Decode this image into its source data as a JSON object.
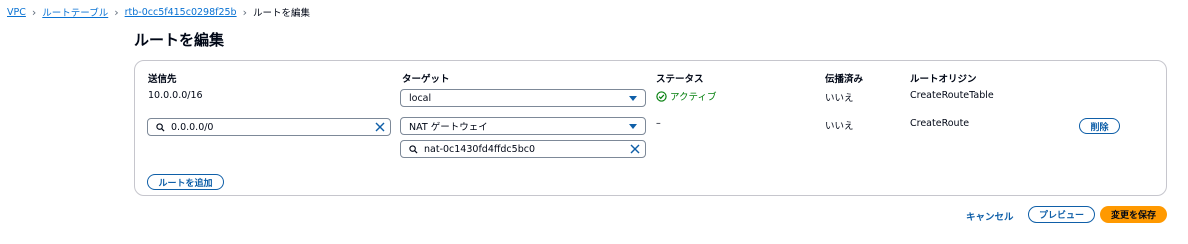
{
  "breadcrumb": {
    "items": [
      "VPC",
      "ルートテーブル",
      "rtb-0cc5f415c0298f25b"
    ],
    "current": "ルートを編集"
  },
  "page": {
    "title": "ルートを編集"
  },
  "table": {
    "headers": {
      "destination": "送信先",
      "target": "ターゲット",
      "status": "ステータス",
      "propagated": "伝播済み",
      "origin": "ルートオリジン"
    },
    "rows": [
      {
        "destination": "10.0.0.0/16",
        "target_select": "local",
        "status": "アクティブ",
        "propagated": "いいえ",
        "origin": "CreateRouteTable"
      },
      {
        "destination_input": "0.0.0.0/0",
        "target_select": "NAT ゲートウェイ",
        "target_search": "nat-0c1430fd4ffdc5bc0",
        "status": "–",
        "propagated": "いいえ",
        "origin": "CreateRoute",
        "remove_label": "削除"
      }
    ],
    "add_route_label": "ルートを追加"
  },
  "footer": {
    "cancel_label": "キャンセル",
    "preview_label": "プレビュー",
    "save_label": "変更を保存"
  },
  "colors": {
    "link": "#0972d3",
    "button_text": "#0f5fa8",
    "success": "#037f0c",
    "primary": "#ff9900"
  },
  "icons": [
    "chevron-right-icon",
    "search-icon",
    "clear-icon",
    "caret-down-icon",
    "check-circle-icon"
  ]
}
